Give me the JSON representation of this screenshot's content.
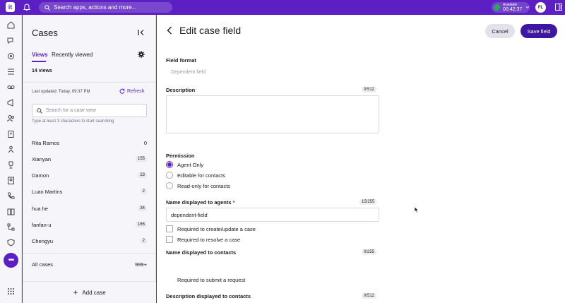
{
  "topbar": {
    "logo": "it",
    "search_placeholder": "Search apps, actions and more...",
    "status_label": "Available",
    "status_time": "00:42:37",
    "avatar_initials": "FL"
  },
  "cases_panel": {
    "title": "Cases",
    "tabs": [
      {
        "label": "Views",
        "active": true
      },
      {
        "label": "Recently viewed",
        "active": false
      }
    ],
    "views_count": "14 views",
    "last_updated": "Last updated:  Today, 09:37 PM",
    "refresh_label": "Refresh",
    "search_placeholder": "Search for a case view",
    "search_hint": "Type at least 3 characters to start searching",
    "views": [
      {
        "name": "Rita Ramos",
        "count": "0"
      },
      {
        "name": "Xianyan",
        "count": "155"
      },
      {
        "name": "Damon",
        "count": "23"
      },
      {
        "name": "Luan Martins",
        "count": "2"
      },
      {
        "name": "hua he",
        "count": "34"
      },
      {
        "name": "fanfan-u",
        "count": "165"
      },
      {
        "name": "Chengyu",
        "count": "2"
      },
      {
        "name": "All cases",
        "count": "999+"
      }
    ],
    "add_case_label": "Add case"
  },
  "main": {
    "title": "Edit case field",
    "cancel_label": "Cancel",
    "save_label": "Save field",
    "field_format_label": "Field format",
    "field_format_value": "Dependent field",
    "description_label": "Description",
    "description_counter": "0/512",
    "permission_label": "Permission",
    "permission_options": [
      {
        "label": "Agent Only",
        "selected": true
      },
      {
        "label": "Editable for contacts",
        "selected": false
      },
      {
        "label": "Read-only for contacts",
        "selected": false
      }
    ],
    "agents_name_label": "Name displayed to agents",
    "agents_name_required_mark": "*",
    "agents_name_counter": "15/255",
    "agents_name_value": "dependent-field",
    "required_create_label": "Required to create/update a case",
    "required_resolve_label": "Required to resolve a case",
    "contacts_name_label": "Name displayed to contacts",
    "contacts_name_counter": "0/255",
    "required_submit_label": "Required to submit a request",
    "contacts_desc_label": "Description displayed to contacts",
    "contacts_desc_counter": "0/512"
  },
  "colors": {
    "brand": "#5b1fc4",
    "save_button": "#3f16a4",
    "status_green": "#2ca85a"
  }
}
